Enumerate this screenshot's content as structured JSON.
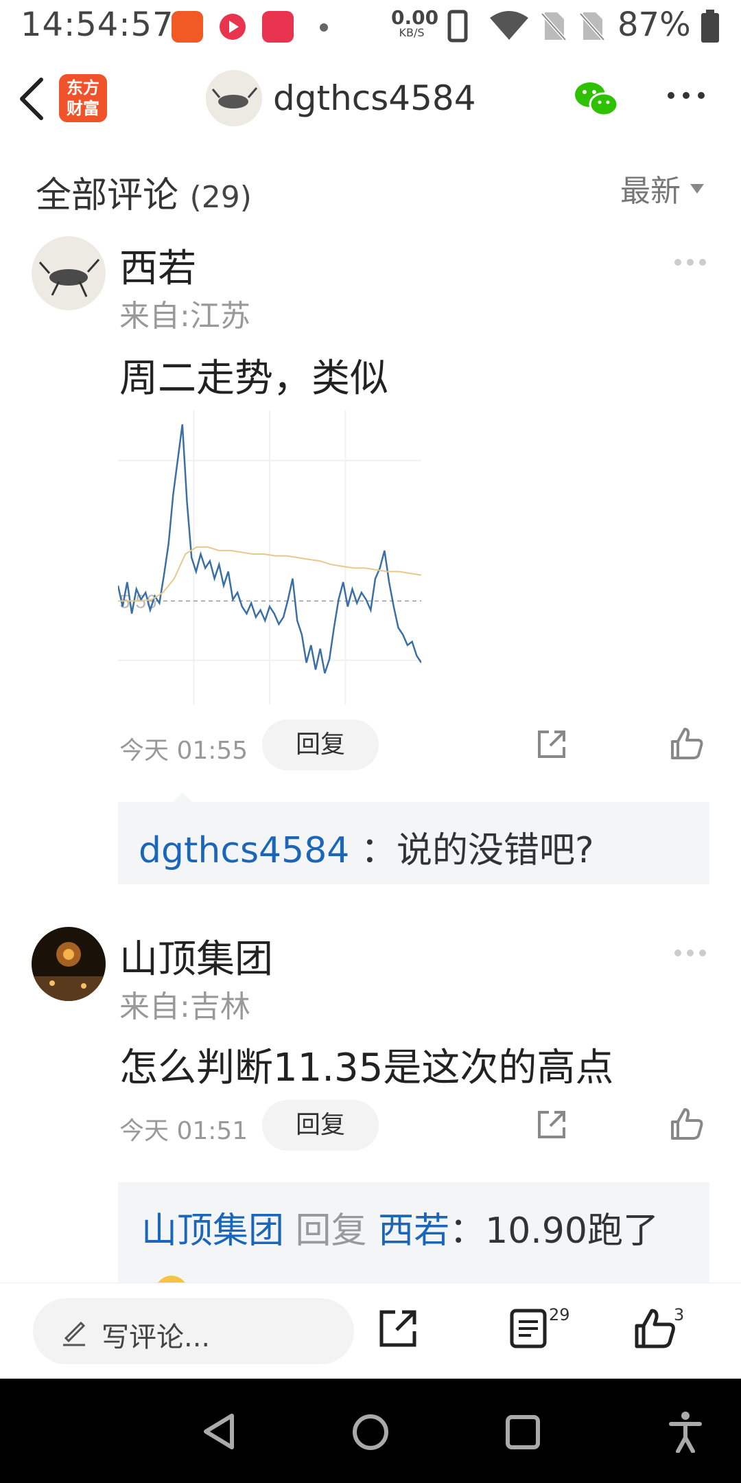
{
  "status_bar": {
    "time": "14:54:57",
    "net_speed_value": "0.00",
    "net_speed_unit": "KB/S",
    "battery": "87%"
  },
  "nav": {
    "logo_line1": "东方",
    "logo_line2": "财富",
    "username": "dgthcs4584"
  },
  "comments_header": {
    "title": "全部评论",
    "count": "(29)",
    "sort": "最新"
  },
  "comments": [
    {
      "name": "西若",
      "from": "来自:江苏",
      "text": "周二走势，类似",
      "time": "今天 01:55",
      "reply_label": "回复",
      "replies": [
        {
          "user": "dgthcs4584",
          "sep": "：",
          "text": "说的没错吧?"
        }
      ]
    },
    {
      "name": "山顶集团",
      "from": "来自:吉林",
      "text": "怎么判断11.35是这次的高点",
      "time": "今天 01:51",
      "reply_label": "回复",
      "replies": [
        {
          "user": "山顶集团",
          "action": "回复",
          "target": "西若",
          "text": "：10.90跑了"
        }
      ]
    }
  ],
  "chart_data": {
    "type": "line",
    "baseline_label": "5.56",
    "series": [
      {
        "values": [
          6.0,
          5.4,
          6.1,
          5.2,
          5.9,
          5.6,
          5.8,
          5.3,
          5.7,
          5.5,
          6.3,
          7.2,
          8.6,
          9.6,
          10.6,
          8.4,
          6.8,
          6.4,
          6.9,
          6.5,
          6.7,
          6.2,
          6.6,
          6.0,
          6.4,
          5.6,
          5.8,
          5.4,
          5.2,
          5.5,
          5.1,
          5.3,
          5.0,
          5.4,
          5.2,
          4.9,
          5.1,
          5.6,
          6.2,
          5.0,
          4.6,
          3.8,
          4.3,
          3.6,
          4.2,
          3.5,
          3.9,
          4.8,
          5.6,
          6.1,
          5.4,
          5.9,
          5.5,
          5.8,
          5.6,
          5.3,
          6.2,
          6.5,
          7.0,
          6.1,
          5.4,
          4.8,
          4.6,
          4.3,
          4.4,
          4.0,
          3.8
        ]
      },
      {
        "values": [
          5.56,
          5.56,
          5.56,
          5.6,
          5.8,
          6.2,
          6.9,
          7.1,
          7.1,
          7.0,
          7.0,
          6.95,
          6.9,
          6.9,
          6.85,
          6.85,
          6.8,
          6.75,
          6.7,
          6.6,
          6.55,
          6.5,
          6.5,
          6.45,
          6.4,
          6.4,
          6.35,
          6.3
        ]
      }
    ]
  },
  "bottom_bar": {
    "write_placeholder": "写评论...",
    "comment_count": "29",
    "like_count": "3"
  },
  "colors": {
    "accent_blue": "#1a66b8",
    "logo_orange": "#f0532a",
    "wechat_green": "#2dc100",
    "chart_line": "#3a6fa6",
    "chart_avg": "#e6c98a"
  }
}
